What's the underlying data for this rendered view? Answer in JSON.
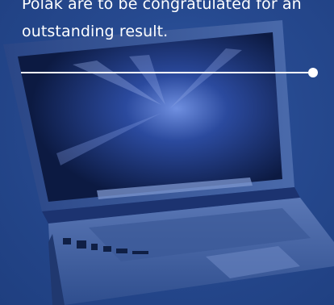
{
  "caption": {
    "line1": "Polak are to be congratulated for an",
    "line2": "outstanding result."
  },
  "colors": {
    "background": "#24478f",
    "text": "#ffffff",
    "laptop_body": "#3d5c9c",
    "screen": "#0e1c45"
  },
  "icons": {
    "device": "laptop-icon",
    "divider_end": "dot-icon"
  }
}
